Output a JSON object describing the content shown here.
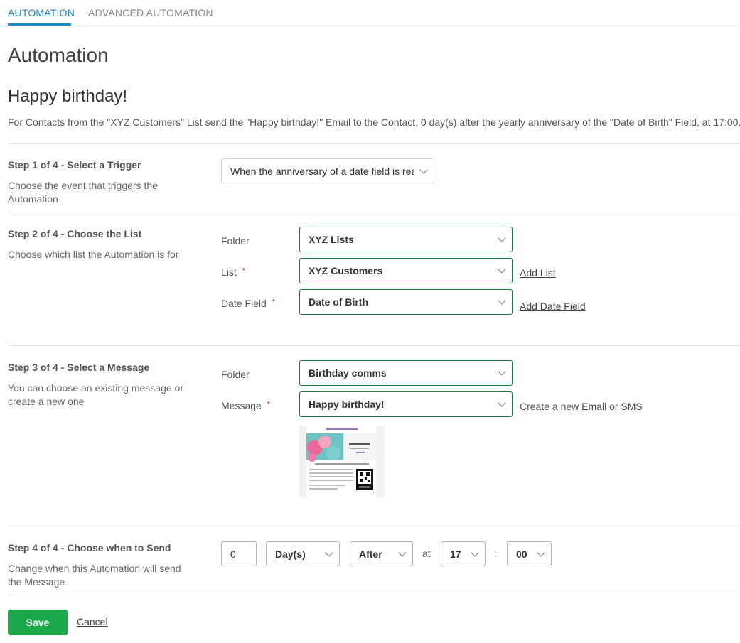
{
  "tabs": [
    {
      "label": "AUTOMATION",
      "active": true
    },
    {
      "label": "ADVANCED AUTOMATION",
      "active": false
    }
  ],
  "page_title": "Automation",
  "automation_name": "Happy birthday!",
  "description": "For Contacts from the \"XYZ Customers\" List send the \"Happy birthday!\" Email to the Contact, 0 day(s) after the yearly anniversary of the \"Date of Birth\" Field, at 17:00.",
  "step1": {
    "title": "Step 1 of 4 - Select a Trigger",
    "desc": "Choose the event that triggers the Automation",
    "trigger_value": "When the anniversary of a date field is reached"
  },
  "step2": {
    "title": "Step 2 of 4 - Choose the List",
    "desc": "Choose which list the Automation is for",
    "folder_label": "Folder",
    "folder_value": "XYZ Lists",
    "list_label": "List",
    "list_value": "XYZ Customers",
    "add_list": "Add List",
    "date_field_label": "Date Field",
    "date_field_value": "Date of Birth",
    "add_date_field": "Add Date Field",
    "required_mark": "*"
  },
  "step3": {
    "title": "Step 3 of 4 - Select a Message",
    "desc": "You can choose an existing message or create a new one",
    "folder_label": "Folder",
    "folder_value": "Birthday comms",
    "message_label": "Message",
    "message_value": "Happy birthday!",
    "create_text": "Create a new",
    "email_link": "Email",
    "or_text": "or",
    "sms_link": "SMS"
  },
  "step4": {
    "title": "Step 4 of 4 - Choose when to Send",
    "desc": "Change when this Automation will send the Message",
    "amount": "0",
    "unit": "Day(s)",
    "relation": "After",
    "at_label": "at",
    "hour": "17",
    "colon": ":",
    "minute": "00"
  },
  "actions": {
    "save": "Save",
    "cancel": "Cancel"
  },
  "colors": {
    "accent": "#1e88c9",
    "save_green": "#1aa84a",
    "select_border_green": "#1c7a44",
    "required_red": "#d0021b"
  }
}
